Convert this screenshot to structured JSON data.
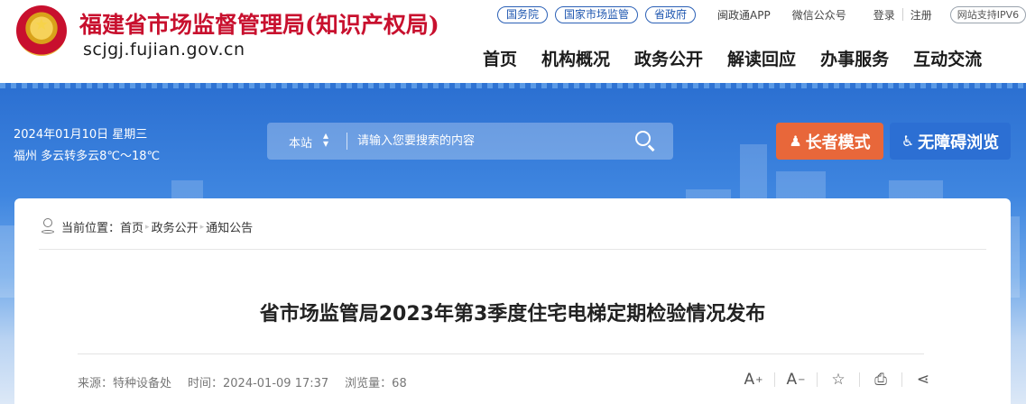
{
  "header": {
    "site_name": "福建省市场监督管理局(知识产权局)",
    "domain": "scjgj.fujian.gov.cn",
    "top_links": [
      "国务院",
      "国家市场监管",
      "省政府"
    ],
    "app_link": "闽政通APP",
    "wechat_link": "微信公众号",
    "login": "登录",
    "register": "注册",
    "ipv6": "网站支持IPV6",
    "nav": [
      "首页",
      "机构概况",
      "政务公开",
      "解读回应",
      "办事服务",
      "互动交流"
    ]
  },
  "banner": {
    "date": "2024年01月10日 星期三",
    "weather": "福州 多云转多云8℃～18℃",
    "search": {
      "scope": "本站",
      "placeholder": "请输入您要搜索的内容"
    },
    "elder_mode": "长者模式",
    "accessibility": "无障碍浏览"
  },
  "breadcrumb": {
    "prefix": "当前位置：",
    "items": [
      "首页",
      "政务公开",
      "通知公告"
    ]
  },
  "article": {
    "title": "省市场监管局2023年第3季度住宅电梯定期检验情况发布",
    "source": "来源：特种设备处",
    "time": "时间：2024-01-09 17:37",
    "views": "浏览量：68"
  },
  "tools": {
    "font_bigger": "A",
    "font_smaller": "A"
  },
  "colors": {
    "brand_red": "#c8102e",
    "banner_blue": "#2b6fd1",
    "elder_orange": "#e8673a",
    "access_blue": "#2c6fd3"
  },
  "icons": [
    "emblem-icon",
    "chevron-updown-icon",
    "search-icon",
    "elder-icon",
    "wheelchair-icon",
    "location-pin-icon",
    "font-increase-icon",
    "font-decrease-icon",
    "star-icon",
    "print-icon",
    "share-icon"
  ]
}
